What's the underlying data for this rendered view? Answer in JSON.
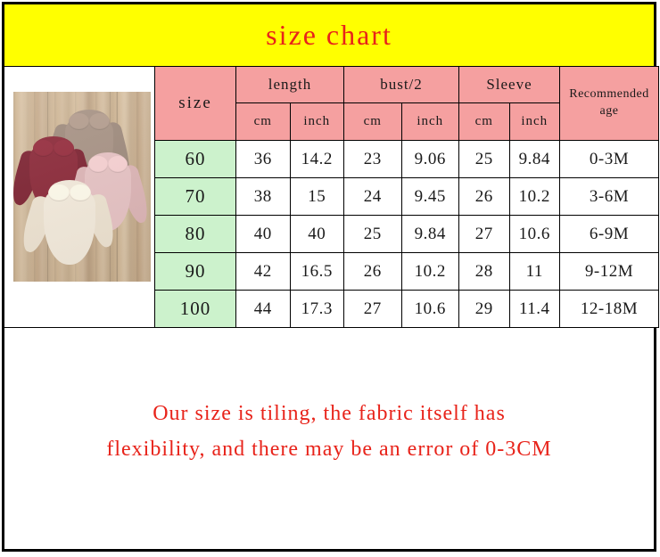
{
  "title": "size chart",
  "colors": {
    "title_band": "#FFFF00",
    "title_text": "#E8231A",
    "header_cell": "#F5A0A0",
    "size_cell": "#CCF2CC",
    "note_text": "#E8231A",
    "border": "#000000"
  },
  "table": {
    "header": {
      "size": "size",
      "groups": [
        "length",
        "bust/2",
        "Sleeve"
      ],
      "units": [
        "cm",
        "inch",
        "cm",
        "inch",
        "cm",
        "inch"
      ],
      "recommended_age": "Recommended age"
    },
    "rows": [
      {
        "size": "60",
        "length_cm": "36",
        "length_inch": "14.2",
        "bust_cm": "23",
        "bust_inch": "9.06",
        "sleeve_cm": "25",
        "sleeve_inch": "9.84",
        "age": "0-3M"
      },
      {
        "size": "70",
        "length_cm": "38",
        "length_inch": "15",
        "bust_cm": "24",
        "bust_inch": "9.45",
        "sleeve_cm": "26",
        "sleeve_inch": "10.2",
        "age": "3-6M"
      },
      {
        "size": "80",
        "length_cm": "40",
        "length_inch": "40",
        "bust_cm": "25",
        "bust_inch": "9.84",
        "sleeve_cm": "27",
        "sleeve_inch": "10.6",
        "age": "6-9M"
      },
      {
        "size": "90",
        "length_cm": "42",
        "length_inch": "16.5",
        "bust_cm": "26",
        "bust_inch": "10.2",
        "sleeve_cm": "28",
        "sleeve_inch": "11",
        "age": "9-12M"
      },
      {
        "size": "100",
        "length_cm": "44",
        "length_inch": "17.3",
        "bust_cm": "27",
        "bust_inch": "10.6",
        "sleeve_cm": "29",
        "sleeve_inch": "11.4",
        "age": "12-18M"
      }
    ]
  },
  "product_photo": {
    "alt": "four baby rompers with peter-pan collars on wooden background",
    "garment_colors": [
      "#A79284",
      "#8B2838",
      "#E7C3C4",
      "#F4EBDC"
    ]
  },
  "note": {
    "line1": "Our size is tiling, the fabric itself has",
    "line2": "flexibility, and there may be an error of 0-3CM"
  }
}
